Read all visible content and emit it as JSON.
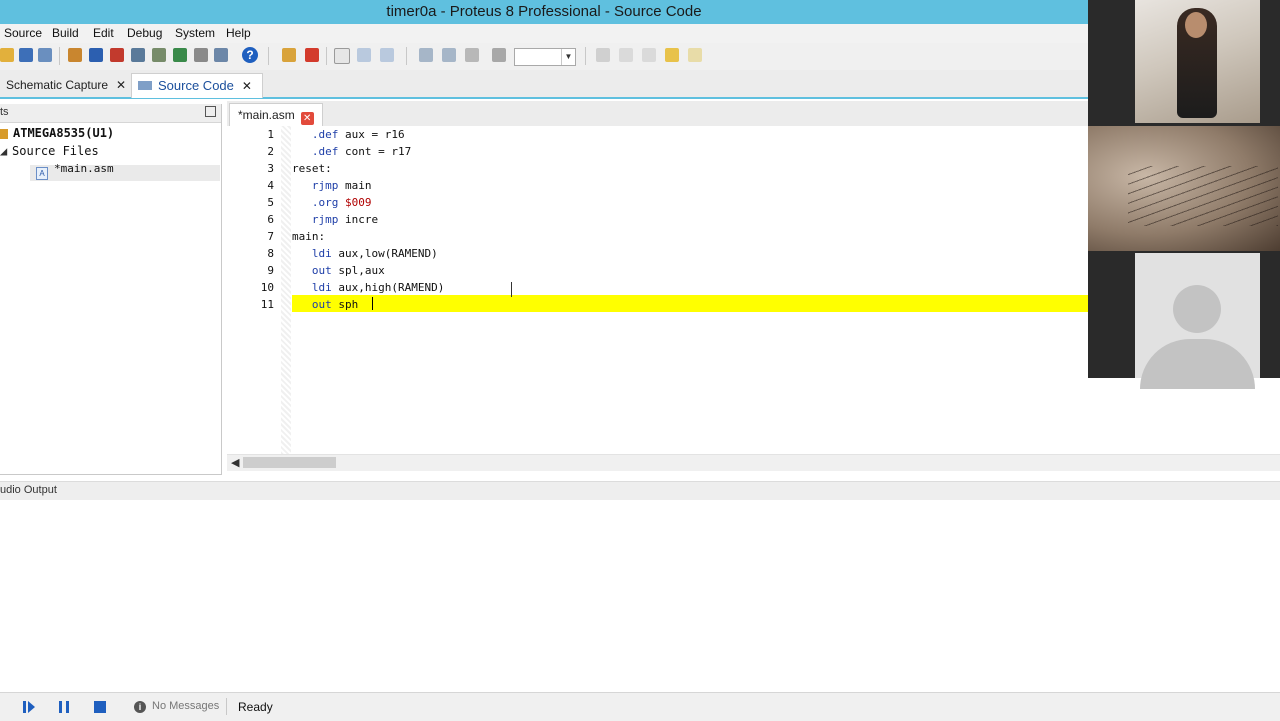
{
  "window": {
    "title": "timer0a - Proteus 8 Professional - Source Code"
  },
  "menu": [
    "Source",
    "Build",
    "Edit",
    "Debug",
    "System",
    "Help"
  ],
  "toolbar": {
    "zoom_value": ""
  },
  "doc_tabs": [
    {
      "label": "Schematic Capture"
    },
    {
      "label": "Source Code"
    }
  ],
  "project": {
    "header": "ts",
    "root": "ATMEGA8535(U1)",
    "folder": "Source Files",
    "file": "*main.asm"
  },
  "editor": {
    "tab_label": "*main.asm",
    "lines": [
      {
        "n": "1",
        "indent": "   ",
        "kw": ".def",
        "rest": " aux = r16",
        "num": ""
      },
      {
        "n": "2",
        "indent": "   ",
        "kw": ".def",
        "rest": " cont = r17",
        "num": ""
      },
      {
        "n": "3",
        "indent": "",
        "kw": "",
        "rest": "reset:",
        "num": ""
      },
      {
        "n": "4",
        "indent": "   ",
        "kw": "rjmp",
        "rest": " main",
        "num": ""
      },
      {
        "n": "5",
        "indent": "   ",
        "kw": ".org",
        "rest": " ",
        "num": "$009"
      },
      {
        "n": "6",
        "indent": "   ",
        "kw": "rjmp",
        "rest": " incre",
        "num": ""
      },
      {
        "n": "7",
        "indent": "",
        "kw": "",
        "rest": "main:",
        "num": ""
      },
      {
        "n": "8",
        "indent": "   ",
        "kw": "ldi",
        "rest": " aux,low(RAMEND)",
        "num": ""
      },
      {
        "n": "9",
        "indent": "   ",
        "kw": "out",
        "rest": " spl,aux",
        "num": ""
      },
      {
        "n": "10",
        "indent": "   ",
        "kw": "ldi",
        "rest": " aux,high(RAMEND)",
        "num": ""
      },
      {
        "n": "11",
        "indent": "   ",
        "kw": "out",
        "rest": " sph",
        "num": ""
      }
    ]
  },
  "output": {
    "header": "udio Output"
  },
  "status": {
    "messages": "No Messages",
    "state": "Ready"
  },
  "colors": {
    "accent": "#5fc0df",
    "current_line": "#ffff00",
    "keyword": "#1f3fa8",
    "number": "#b00000"
  }
}
